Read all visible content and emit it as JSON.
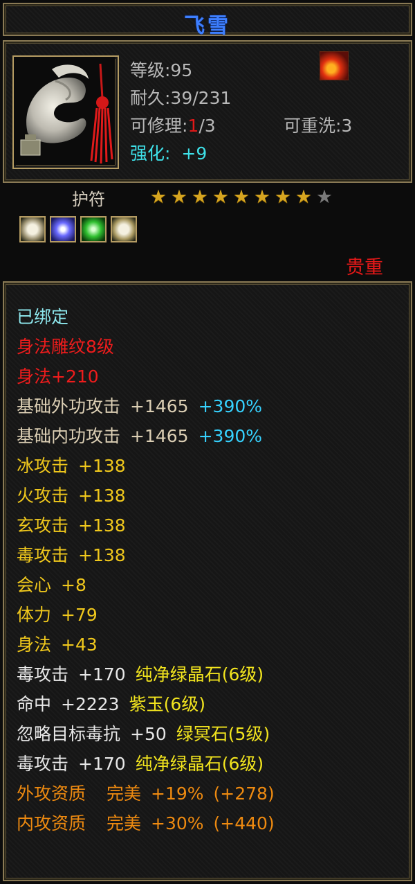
{
  "title": "飞雪",
  "colors": {
    "title": "#3d7fff",
    "border": "#8a7a55",
    "rarity": "#e41818",
    "stars_on": "#d6a520",
    "stars_off": "#7a7a7a"
  },
  "info": {
    "level": "等级:95",
    "durability": "耐久:39/231",
    "repair_label": "可修理:",
    "repair_count": "1",
    "repair_max": "/3",
    "rewash": "可重洗:3",
    "enhance_label": "强化:",
    "enhance_value": "+9",
    "item_icon": "jade-pendant-icon",
    "element_icon": "fire-icon"
  },
  "charm": {
    "label": "护符",
    "stars_filled": 8,
    "stars_total": 9,
    "gem_icons": [
      "pale-gem-icon",
      "blue-gem-icon",
      "green-gem-icon",
      "pale-gem-icon"
    ],
    "rarity": "贵重"
  },
  "stats": {
    "bound": "已绑定",
    "engrave": "身法雕纹8级",
    "agility_bonus": "身法+210",
    "outer_attack": {
      "name": "基础外功攻击",
      "value": "+1465",
      "pct": "+390%"
    },
    "inner_attack": {
      "name": "基础内功攻击",
      "value": "+1465",
      "pct": "+390%"
    },
    "ice": {
      "name": "冰攻击",
      "value": "+138"
    },
    "fire": {
      "name": "火攻击",
      "value": "+138"
    },
    "mystic": {
      "name": "玄攻击",
      "value": "+138"
    },
    "poison": {
      "name": "毒攻击",
      "value": "+138"
    },
    "crit": {
      "name": "会心",
      "value": "+8"
    },
    "stamina": {
      "name": "体力",
      "value": "+79"
    },
    "agility": {
      "name": "身法",
      "value": "+43"
    },
    "gem1": {
      "name": "毒攻击",
      "value": "+170",
      "gem": "纯净绿晶石(6级)"
    },
    "gem2": {
      "name": "命中",
      "value": "+2223",
      "gem": "紫玉(6级)"
    },
    "gem3": {
      "name": "忽略目标毒抗",
      "value": "+50",
      "gem": "绿冥石(5级)"
    },
    "gem4": {
      "name": "毒攻击",
      "value": "+170",
      "gem": "纯净绿晶石(6级)"
    },
    "outer_quality": {
      "name": "外攻资质",
      "grade": "完美",
      "pct": "+19%",
      "bonus": "(+278)"
    },
    "inner_quality": {
      "name": "内攻资质",
      "grade": "完美",
      "pct": "+30%",
      "bonus": "(+440)"
    }
  }
}
